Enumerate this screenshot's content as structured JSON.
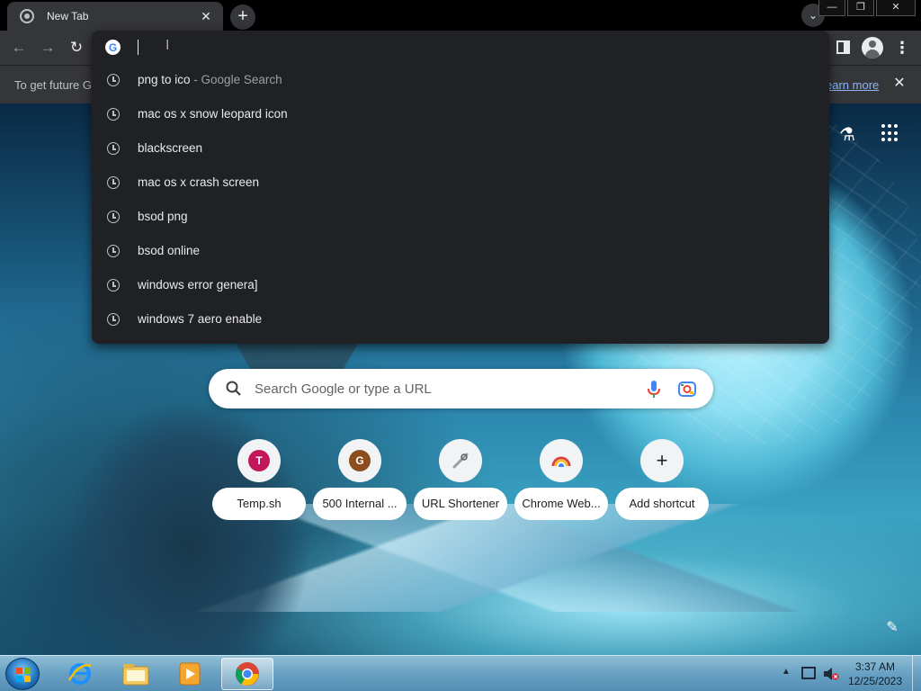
{
  "tab": {
    "title": "New Tab",
    "close": "✕"
  },
  "toolbar": {
    "back": "←",
    "forward": "→",
    "reload": "↻"
  },
  "infobar": {
    "text": "To get future G",
    "link": "earn more",
    "close": "✕"
  },
  "omnibox": {
    "input_value": "",
    "suggestions": [
      {
        "text": "png to ico",
        "suffix": " - Google Search"
      },
      {
        "text": "mac os x snow leopard icon",
        "suffix": ""
      },
      {
        "text": "blackscreen",
        "suffix": ""
      },
      {
        "text": "mac os x crash screen",
        "suffix": ""
      },
      {
        "text": "bsod png",
        "suffix": ""
      },
      {
        "text": "bsod online",
        "suffix": ""
      },
      {
        "text": "windows error genera]",
        "suffix": ""
      },
      {
        "text": "windows 7 aero enable",
        "suffix": ""
      }
    ]
  },
  "search": {
    "placeholder": "Search Google or type a URL"
  },
  "shortcuts": [
    {
      "label": "Temp.sh",
      "letter": "T",
      "color": "#c2185b"
    },
    {
      "label": "500 Internal ...",
      "letter": "G",
      "color": "#8d4e1f"
    },
    {
      "label": "URL Shortener",
      "letter": "",
      "color": "#9aa0a6"
    },
    {
      "label": "Chrome Web...",
      "letter": "",
      "color": "#db4437"
    },
    {
      "label": "Add shortcut",
      "letter": "+",
      "color": ""
    }
  ],
  "taskbar": {
    "clock_time": "3:37 AM",
    "clock_date": "12/25/2023"
  },
  "colors": {
    "chrome_dark": "#35363a",
    "popup_bg": "#202124",
    "link_blue": "#8ab4f8"
  }
}
